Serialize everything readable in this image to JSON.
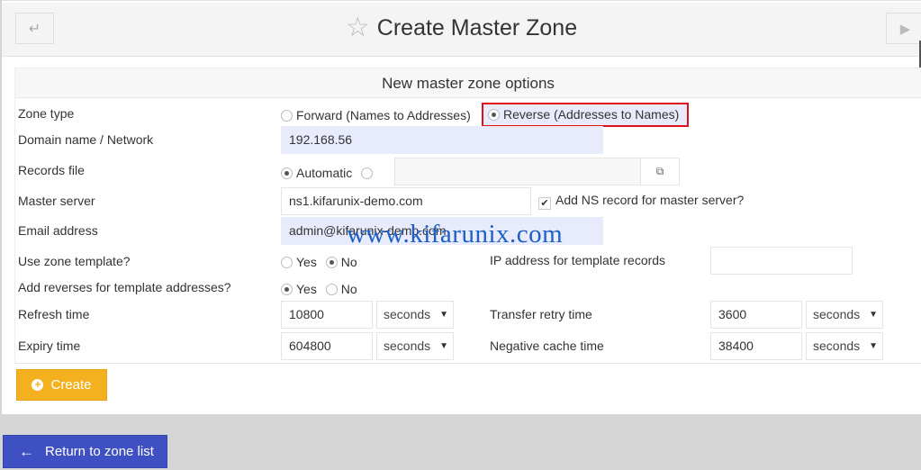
{
  "header": {
    "title": "Create Master Zone",
    "back_icon": "↵",
    "forward_icon": "▶",
    "star_icon": "☆"
  },
  "form": {
    "section_title": "New master zone options",
    "zone_type": {
      "label": "Zone type",
      "options": [
        {
          "label": "Forward (Names to Addresses)",
          "selected": false
        },
        {
          "label": "Reverse (Addresses to Names)",
          "selected": true
        }
      ]
    },
    "domain": {
      "label": "Domain name / Network",
      "value": "192.168.56"
    },
    "records_file": {
      "label": "Records file",
      "automatic_label": "Automatic",
      "automatic_selected": true,
      "custom_value": "",
      "chooser_icon": "⧉"
    },
    "master_server": {
      "label": "Master server",
      "value": "ns1.kifarunix-demo.com",
      "add_ns_label": "Add NS record for master server?",
      "add_ns_checked": true,
      "check_icon": "✔"
    },
    "email": {
      "label": "Email address",
      "value": "admin@kifarunix-demo.com"
    },
    "use_template": {
      "label": "Use zone template?",
      "yes": "Yes",
      "no": "No",
      "selected": "No"
    },
    "template_ip": {
      "label": "IP address for template records",
      "value": ""
    },
    "add_reverses": {
      "label": "Add reverses for template addresses?",
      "yes": "Yes",
      "no": "No",
      "selected": "Yes"
    },
    "refresh": {
      "label": "Refresh time",
      "value": "10800",
      "unit": "seconds"
    },
    "transfer_retry": {
      "label": "Transfer retry time",
      "value": "3600",
      "unit": "seconds"
    },
    "expiry": {
      "label": "Expiry time",
      "value": "604800",
      "unit": "seconds"
    },
    "negative_cache": {
      "label": "Negative cache time",
      "value": "38400",
      "unit": "seconds"
    },
    "caret": "▼"
  },
  "watermark": "www.kifarunix.com",
  "buttons": {
    "create": "Create",
    "create_icon": "+",
    "return": "Return to zone list",
    "return_icon": "🡐"
  }
}
